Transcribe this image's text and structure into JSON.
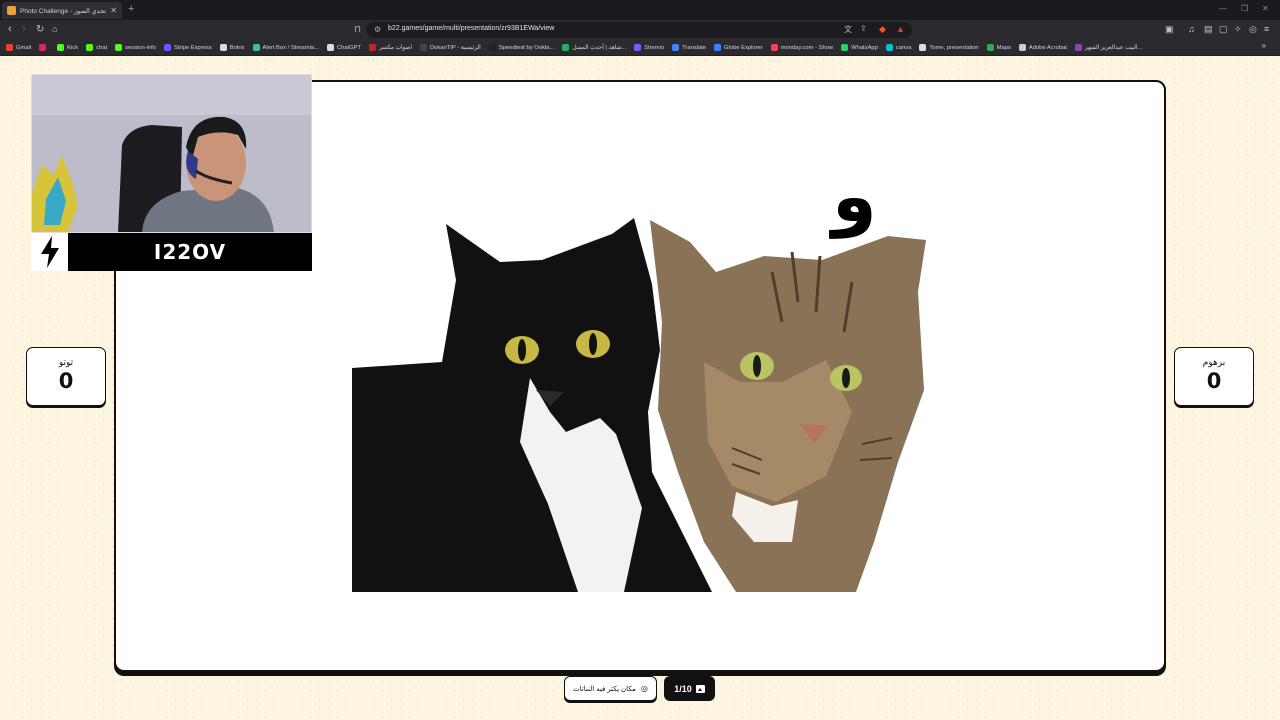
{
  "browser": {
    "tab_title": "Photo Challenge - تحدي الصور",
    "new_tab": "+",
    "url": "b22.games/game/multi/presentation/zr93B1EWa/view",
    "bookmarks": [
      {
        "label": "Gmail",
        "color": "#ea4335"
      },
      {
        "label": "",
        "color": "#e0245e"
      },
      {
        "label": "Kick",
        "color": "#53fc18"
      },
      {
        "label": "chat",
        "color": "#53fc18"
      },
      {
        "label": "session-info",
        "color": "#53fc18"
      },
      {
        "label": "Stripe Express",
        "color": "#635bff"
      },
      {
        "label": "Botrix",
        "color": "#dddddd"
      },
      {
        "label": "Alert Box / Streamla...",
        "color": "#31c3a2"
      },
      {
        "label": "ChatGPT",
        "color": "#dddddd"
      },
      {
        "label": "اصوات مكسر",
        "color": "#cc2222"
      },
      {
        "label": "DokanTIP - الرئيسية",
        "color": "#444444"
      },
      {
        "label": "Speedtest by Ookla...",
        "color": "#222222"
      },
      {
        "label": "شاهد | أحدث المسل...",
        "color": "#1bb55c"
      },
      {
        "label": "Stremio",
        "color": "#7b5bf5"
      },
      {
        "label": "Translate",
        "color": "#4285f4"
      },
      {
        "label": "Globe Explorer",
        "color": "#3b82f6"
      },
      {
        "label": "monday.com - Show",
        "color": "#ff3d57"
      },
      {
        "label": "WhatsApp",
        "color": "#25d366"
      },
      {
        "label": "canva",
        "color": "#00c4cc"
      },
      {
        "label": "Tome, presentation",
        "color": "#dddddd"
      },
      {
        "label": "Maps",
        "color": "#34a853"
      },
      {
        "label": "Adobe Acrobat",
        "color": "#cccccc"
      },
      {
        "label": "البيت عبدالعزيز الشهر...",
        "color": "#8e44ad"
      }
    ]
  },
  "game": {
    "hint_letter": "و",
    "players": {
      "left": {
        "name": "توتو",
        "score": "0"
      },
      "right": {
        "name": "برهوم",
        "score": "0"
      }
    },
    "streamer_name": "I22OV",
    "hint_text": "مكان يكثر فيه النباتات",
    "progress_text": "1/10",
    "progress": {
      "current": 1,
      "total": 10
    }
  }
}
